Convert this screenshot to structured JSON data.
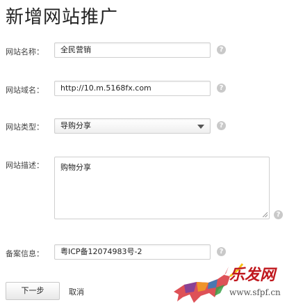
{
  "title": "新增网站推广",
  "fields": {
    "site_name": {
      "label": "网站名称：",
      "value": "全民营销"
    },
    "site_domain": {
      "label": "网站域名：",
      "value": "http://10.m.5168fx.com"
    },
    "site_type": {
      "label": "网站类型：",
      "value": "导购分享"
    },
    "site_desc": {
      "label": "网站描述：",
      "value": "购物分享"
    },
    "icp": {
      "label": "备案信息：",
      "value": "粤ICP备12074983号-2"
    }
  },
  "help_glyph": "?",
  "buttons": {
    "next": "下一步",
    "cancel": "取消"
  },
  "watermark": {
    "brand": "乐发网",
    "url": "www.sfpf.cn"
  },
  "colors": {
    "help": "#c9c9c9",
    "watermark_red": "#c0181e"
  }
}
